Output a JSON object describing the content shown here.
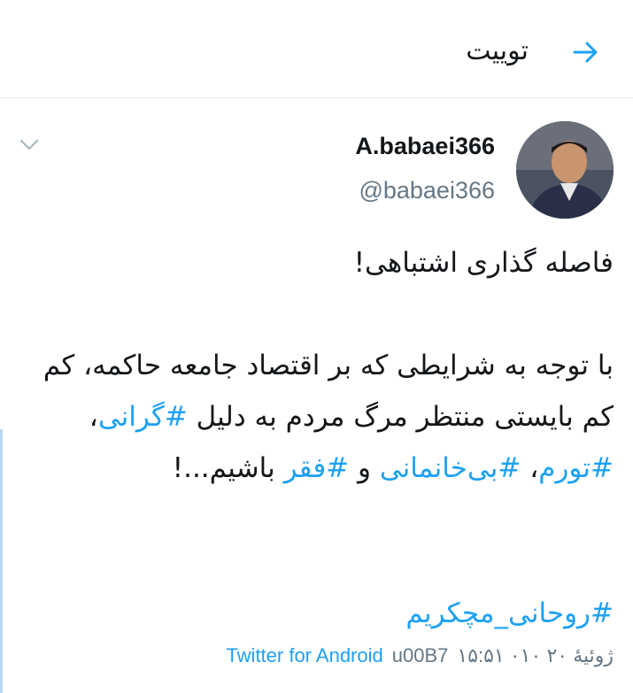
{
  "header": {
    "title": "توییت",
    "back_icon": "arrow-right-icon"
  },
  "author": {
    "display_name": "A.babaei366",
    "handle": "@babaei366"
  },
  "tweet": {
    "line1": "فاصله گذاری اشتباهی!",
    "line2": "با توجه به شرایطی که بر اقتصاد جامعه حاکمه، کم کم بایستی منتظر مرگ مردم به دلیل",
    "tag1": "#گرانی",
    "sep1": "، ",
    "tag2": "#تورم",
    "sep2": "، ",
    "tag3": "#بی‌خانمانی",
    "sep3": " و ",
    "tag4": "#فقر",
    "tail": " باشیم...!",
    "final_tag": "#روحانی_مچکریم"
  },
  "meta": {
    "time": "۱۵:۵۱ ۰۱۰ ژوئیهٔ ۲۰",
    "source_prefix": "u00B7",
    "source": "Twitter for Android"
  },
  "colors": {
    "accent": "#1da1f2",
    "muted": "#657786"
  }
}
